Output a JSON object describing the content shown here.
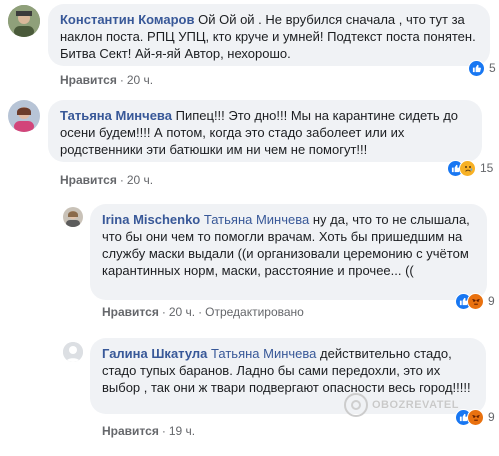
{
  "comments": [
    {
      "author": "Константин Комаров",
      "mention": "",
      "text": "Ой Ой ой . Не врубился сначала , что тут за наклон поста. РПЦ УПЦ, кто круче и умней! Подтекст поста понятен. Битва Сект! Ай-я-яй Автор, нехорошо.",
      "like_label": "Нравится",
      "time": "20 ч.",
      "reactions": [
        "like"
      ],
      "reaction_count": "5"
    },
    {
      "author": "Татьяна Минчева",
      "mention": "",
      "text": "Пипец!!! Это дно!!! Мы на карантине сидеть до осени будем!!!! А потом, когда это стадо заболеет или их родственники эти батюшки им ни чем не помогут!!!",
      "like_label": "Нравится",
      "time": "20 ч.",
      "reactions": [
        "like",
        "sad"
      ],
      "reaction_count": "15"
    },
    {
      "author": "Irina Mischenko",
      "mention": "Татьяна Минчева",
      "text": "ну да, что то не слышала, что бы они чем то помогли врачам. Хоть бы пришедшим на службу маски выдали ((и организовали церемонию с учётом карантинных норм, маски, расстояние и прочее... ((",
      "like_label": "Нравится",
      "time": "20 ч.",
      "edited": "Отредактировано",
      "reactions": [
        "like",
        "angry"
      ],
      "reaction_count": "9"
    },
    {
      "author": "Галина Шкатула",
      "mention": "Татьяна Минчева",
      "text": "действительно стадо, стадо тупых баранов. Ладно бы сами передохли, это их выбор , так они ж твари подвергают опасности весь город!!!!!",
      "like_label": "Нравится",
      "time": "19 ч.",
      "reactions": [
        "like",
        "angry"
      ],
      "reaction_count": "9"
    }
  ],
  "watermark": "OBOZREVATEL",
  "colors": {
    "author": "#385898",
    "bubble": "#f0f2f5",
    "meta": "#65676b",
    "like": "#1877f2",
    "emoji": "#f7b125"
  }
}
